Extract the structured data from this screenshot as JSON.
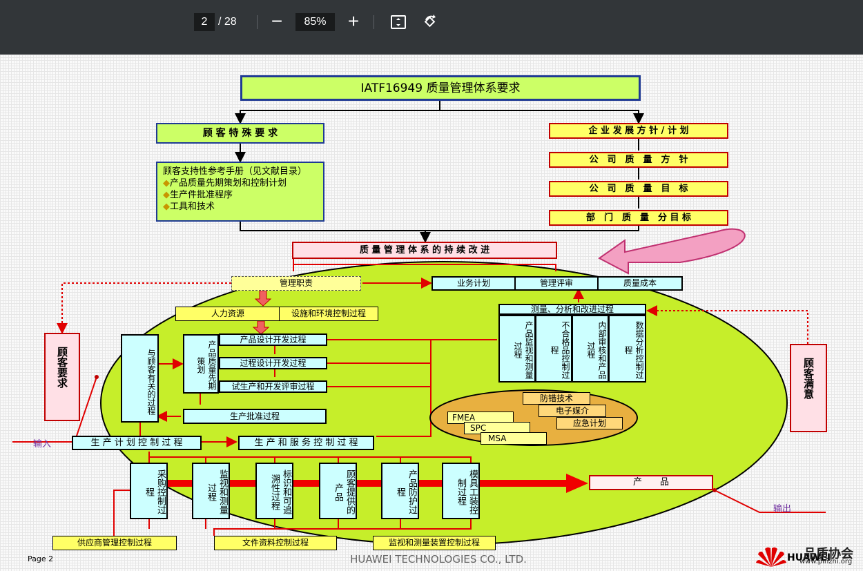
{
  "toolbar": {
    "page_current": "2",
    "page_total": "/ 28",
    "zoom": "85%",
    "minus": "−",
    "plus": "+"
  },
  "diagram": {
    "title": "IATF16949 质量管理体系要求",
    "csr": "顾 客 特 殊 要 求",
    "manual_title": "顾客支持性参考手册（见文献目录）",
    "manual_items": [
      "产品质量先期策划和控制计划",
      "生产件批准程序",
      "工具和技术"
    ],
    "policy": [
      "企 业 发 展 方 针 / 计 划",
      "公　司　质　量　方　针",
      "公　司　质　量　目　标",
      "部　门　质　量　分 目 标"
    ],
    "improve": "质 量 管 理 体 系 的 持 续 改 进",
    "mgmt_resp": "管理职责",
    "biz_plan": "业务计划",
    "mgmt_review": "管理评审",
    "quality_cost": "质量成本",
    "hr": "人力资源",
    "facility": "设施和环境控制过程",
    "measure_title": "测量、分析和改进过程",
    "measure_cols": [
      "产品监视和测量过程",
      "不合格品控制过程",
      "内部审核和产品过程",
      "数据分析控制过程"
    ],
    "customer_process": "与顾客有关的过程",
    "apqp": "产品质量先期策划",
    "design": [
      "产品设计开发过程",
      "过程设计开发过程",
      "试生产和开发评审过程"
    ],
    "ppap": "生产批准过程",
    "customer_req": "顾客要求",
    "customer_sat": "顾客满意",
    "input": "输入",
    "output": "输出",
    "tools_right": [
      "防错技术",
      "电子媒介",
      "应急计划"
    ],
    "tools_left": [
      "FMEA",
      "SPC",
      "MSA"
    ],
    "plan_ctrl": "生 产 计 划 控 制 过 程",
    "prod_ctrl": "生 产 和 服 务 控 制 过 程",
    "proc_cols": [
      "采购控制过程",
      "监视和测量过程",
      "标识和可追溯性过程",
      "顾客提供的产品",
      "产品防护过程",
      "模具工装控制过程"
    ],
    "product": "产　　品",
    "supplier": "供应商管理控制过程",
    "document": "文件资料控制过程",
    "device": "监视和测量装置控制过程",
    "page_label": "Page 2",
    "footer": "HUAWEI TECHNOLOGIES CO., LTD.",
    "watermark": "品质协会",
    "watermark_url": "www.pinzhi.org",
    "brand": "HUAWEI"
  }
}
